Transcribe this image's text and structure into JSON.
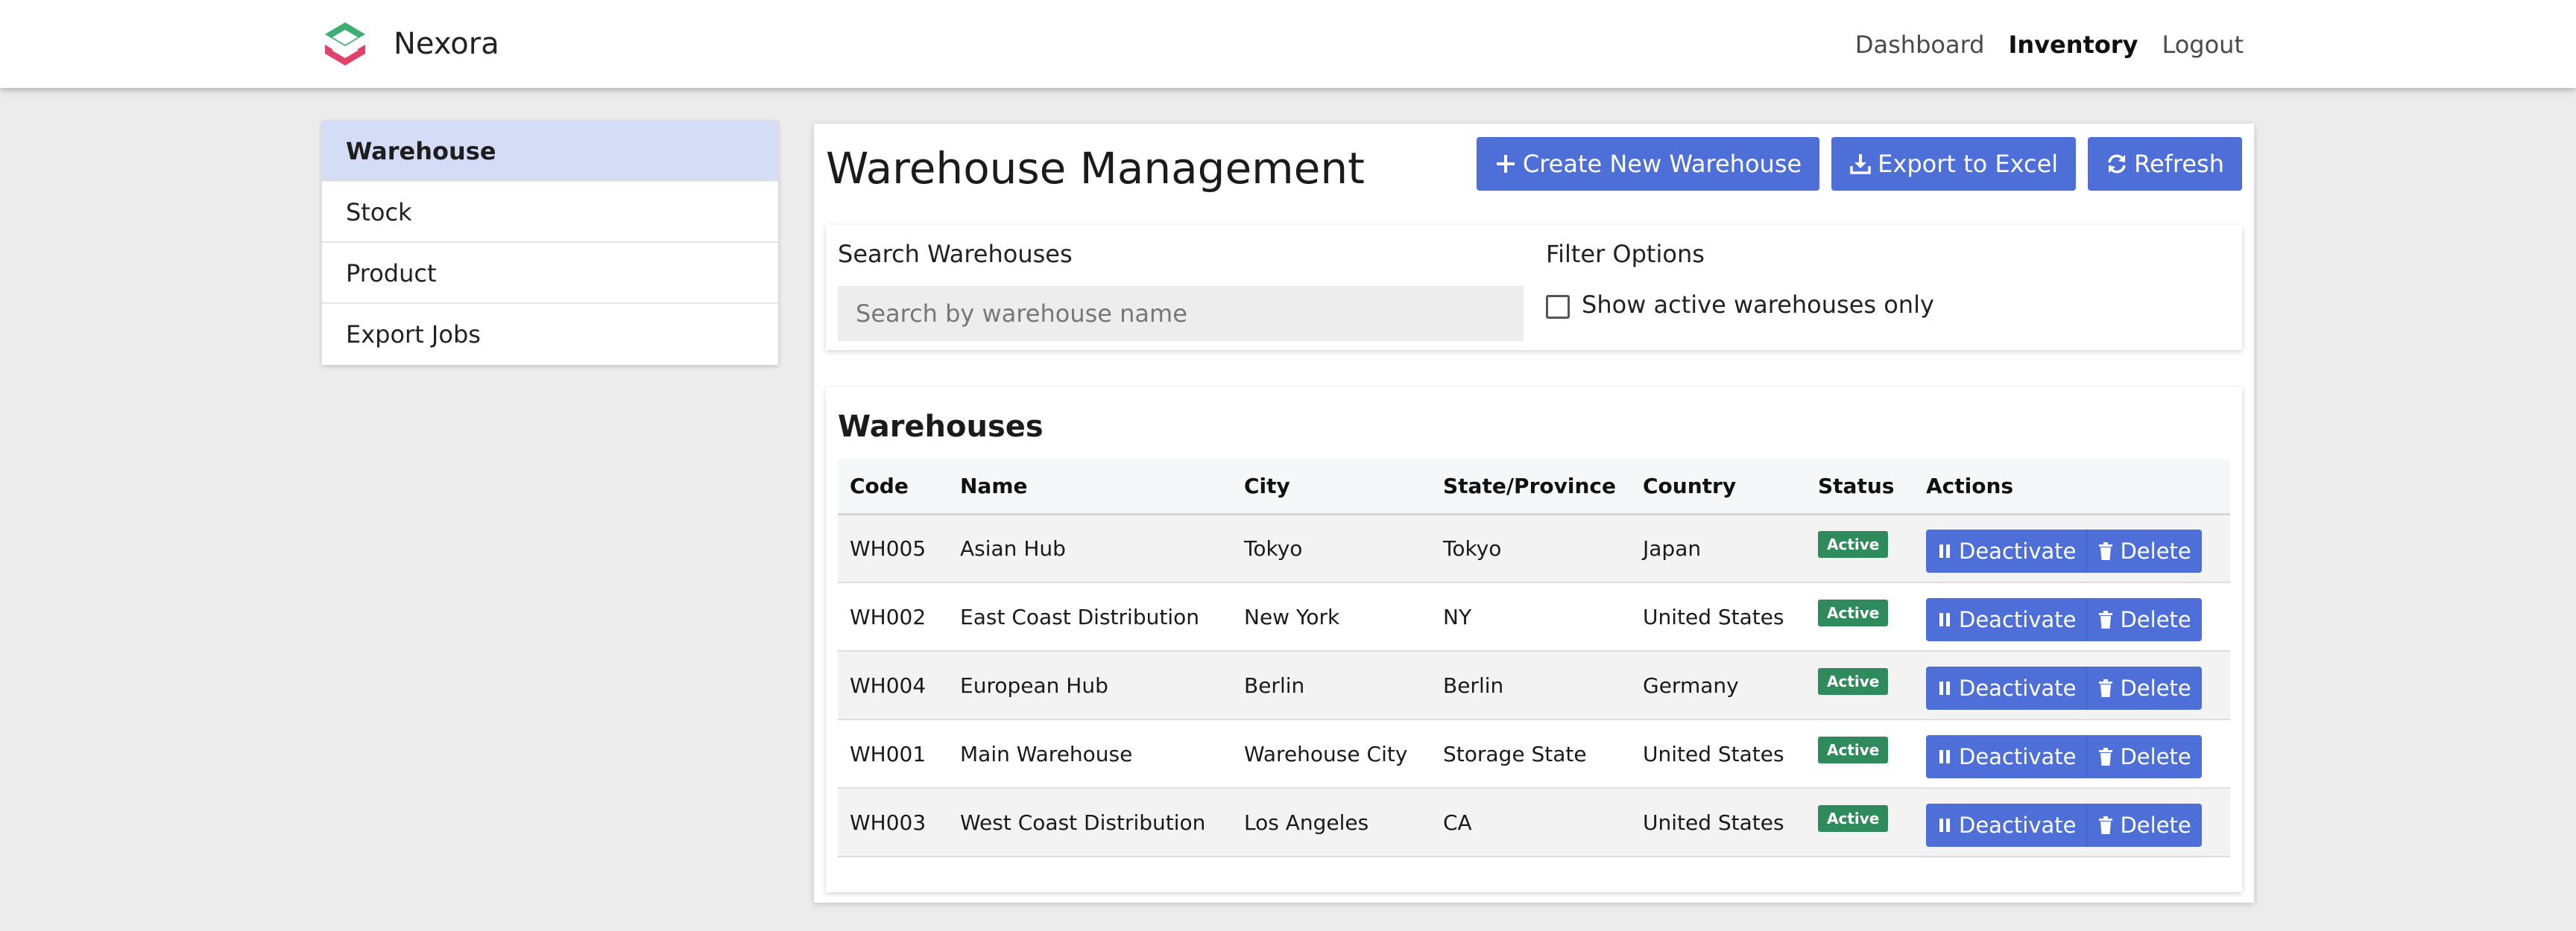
{
  "brand": {
    "name": "Nexora"
  },
  "nav": {
    "links": [
      {
        "label": "Dashboard",
        "active": false
      },
      {
        "label": "Inventory",
        "active": true
      },
      {
        "label": "Logout",
        "active": false
      }
    ]
  },
  "sidebar": {
    "items": [
      {
        "label": "Warehouse",
        "active": true
      },
      {
        "label": "Stock",
        "active": false
      },
      {
        "label": "Product",
        "active": false
      },
      {
        "label": "Export Jobs",
        "active": false
      }
    ]
  },
  "main": {
    "title": "Warehouse Management",
    "toolbar": {
      "create_label": "Create New Warehouse",
      "export_label": "Export to Excel",
      "refresh_label": "Refresh"
    },
    "search": {
      "label": "Search Warehouses",
      "placeholder": "Search by warehouse name",
      "value": ""
    },
    "filter": {
      "label": "Filter Options",
      "checkbox_label": "Show active warehouses only",
      "checked": false
    }
  },
  "table": {
    "title": "Warehouses",
    "columns": [
      "Code",
      "Name",
      "City",
      "State/Province",
      "Country",
      "Status",
      "Actions"
    ],
    "rows": [
      {
        "code": "WH005",
        "name": "Asian Hub",
        "city": "Tokyo",
        "state": "Tokyo",
        "country": "Japan",
        "status": "Active"
      },
      {
        "code": "WH002",
        "name": "East Coast Distribution",
        "city": "New York",
        "state": "NY",
        "country": "United States",
        "status": "Active"
      },
      {
        "code": "WH004",
        "name": "European Hub",
        "city": "Berlin",
        "state": "Berlin",
        "country": "Germany",
        "status": "Active"
      },
      {
        "code": "WH001",
        "name": "Main Warehouse",
        "city": "Warehouse City",
        "state": "Storage State",
        "country": "United States",
        "status": "Active"
      },
      {
        "code": "WH003",
        "name": "West Coast Distribution",
        "city": "Los Angeles",
        "state": "CA",
        "country": "United States",
        "status": "Active"
      }
    ],
    "row_actions": {
      "deactivate_label": "Deactivate",
      "delete_label": "Delete"
    }
  },
  "colors": {
    "primary": "#4e6fd8",
    "active_badge": "#2f8a5c",
    "sidebar_active": "#d5dcf6",
    "page_background": "#ececec"
  },
  "icons": {
    "logo": "nexora-logo-icon",
    "create": "plus-icon",
    "export": "download-icon",
    "refresh": "refresh-icon",
    "deactivate": "pause-icon",
    "delete": "trash-icon"
  }
}
